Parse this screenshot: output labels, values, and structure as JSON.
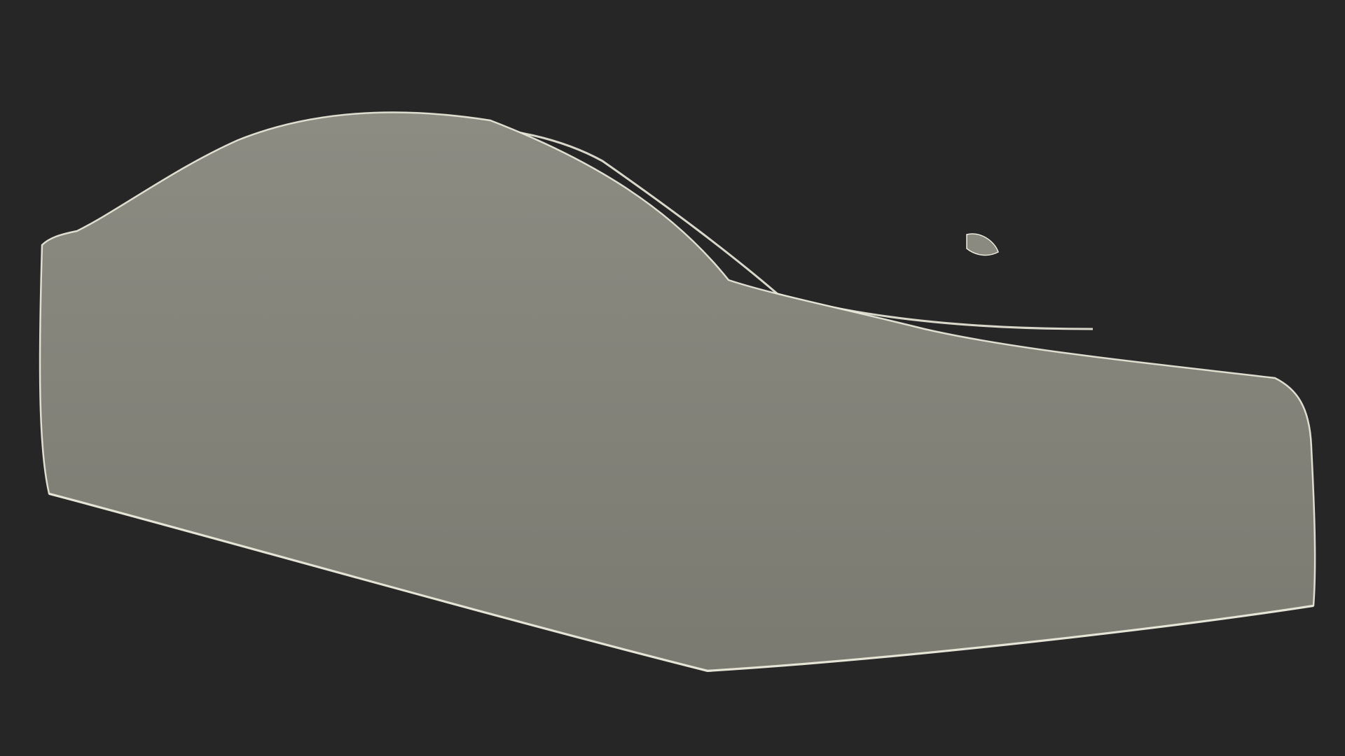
{
  "scene": {
    "background_color": "#262626",
    "surface_color": "#85857c",
    "wire_color": "#ecebdd",
    "subject": "car-cover-wireframe-model"
  }
}
